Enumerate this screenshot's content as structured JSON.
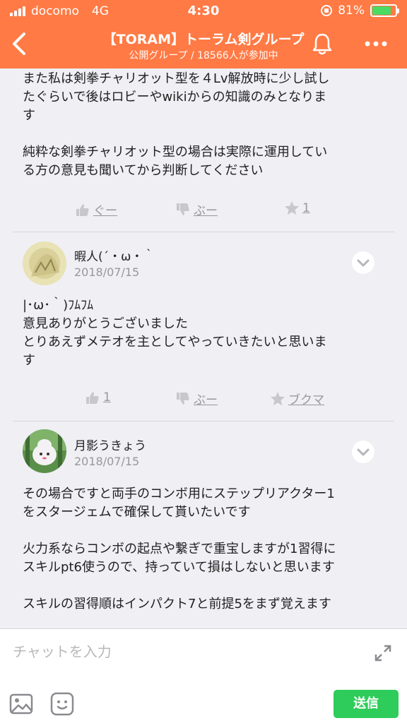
{
  "status_bar": {
    "carrier": "docomo",
    "network": "4G",
    "time": "4:30",
    "battery": "81%",
    "battery_level": 0.81
  },
  "header": {
    "title": "【TORAM】トーラム剣グループ",
    "subtitle": "公開グループ / 18566人が参加中",
    "back_icon": "chevron-left-icon",
    "bell_icon": "bell-icon",
    "more_icon": "more-dots-icon"
  },
  "messages": [
    {
      "text": "また私は剣拳チャリオット型を４Lv解放時に少し試し\nたぐらいで後はロビーやwikiからの知識のみとなりま\nす\n\n純粋な剣拳チャリオット型の場合は実際に運用してい\nる方の意見も聞いてから判断してください",
      "actions": {
        "good": "ぐー",
        "boo": "ぶー",
        "bookmark": "1"
      }
    },
    {
      "author": "暇人(´・ω・｀",
      "date": "2018/07/15",
      "text": "|･ω･｀)ﾌﾑﾌﾑ\n意見ありがとうございました\nとりあえずメテオを主としてやっていきたいと思いま\nす",
      "actions": {
        "good": "1",
        "boo": "ぶー",
        "bookmark": "ブクマ"
      }
    },
    {
      "author": "月影うきょう",
      "date": "2018/07/15",
      "text": "その場合ですと両手のコンボ用にステップリアクター1\nをスタージェムで確保して貰いたいです\n\n火力系ならコンボの起点や繋ぎで重宝しますが1習得に\nスキルpt6使うので、持っていて損はしないと思います\n\nスキルの習得順はインパクト7と前提5をまず覚えます"
    }
  ],
  "composer": {
    "placeholder": "チャットを入力",
    "send_label": "送信"
  },
  "colors": {
    "header_bg": "#ff7a45",
    "send_bg": "#2ecc5a",
    "battery_fill": "#4cd964"
  }
}
